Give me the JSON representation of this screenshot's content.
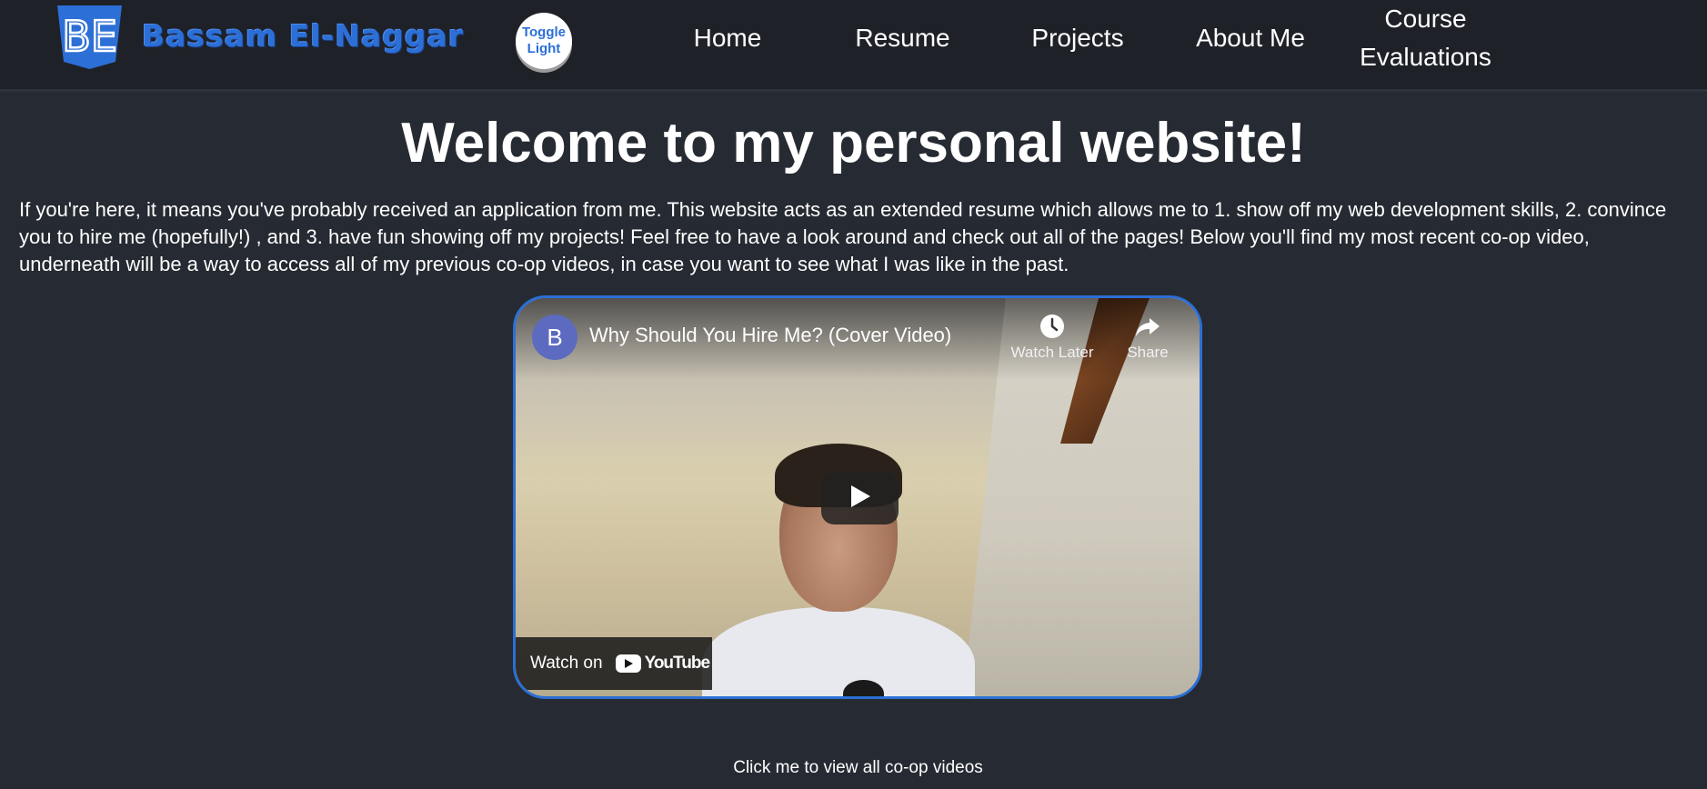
{
  "header": {
    "logo_text": "BE",
    "brand_name": "Bassam El-Naggar",
    "toggle_label_line1": "Toggle",
    "toggle_label_line2": "Light",
    "nav": {
      "home": "Home",
      "resume": "Resume",
      "projects": "Projects",
      "about": "About Me",
      "course_line1": "Course",
      "course_line2": "Evaluations"
    }
  },
  "main": {
    "title": "Welcome to my personal website!",
    "intro": "If you're here, it means you've probably received an application from me. This website acts as an extended resume which allows me to 1. show off my web development skills, 2. convince you to hire me (hopefully!) , and 3. have fun showing off my projects! Feel free to have a look around and check out all of the pages! Below you'll find my most recent co-op video, underneath will be a way to access all of my previous co-op videos, in case you want to see what I was like in the past."
  },
  "video": {
    "channel_initial": "B",
    "title": "Why Should You Hire Me? (Cover Video)",
    "watch_later_label": "Watch Later",
    "share_label": "Share",
    "watch_on_label": "Watch on",
    "youtube_label": "YouTube",
    "icons": {
      "watch_later": "clock-icon",
      "share": "share-arrow-icon",
      "play": "play-icon",
      "youtube": "youtube-logo-icon"
    }
  },
  "footer": {
    "coop_link": "Click me to view all co-op videos"
  },
  "colors": {
    "accent": "#2c6fd6",
    "background": "#262a32",
    "navbar": "#1f2128"
  }
}
